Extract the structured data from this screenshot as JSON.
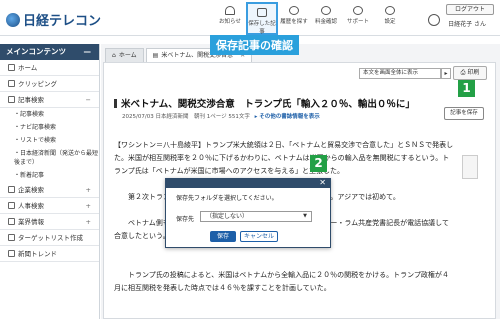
{
  "header": {
    "logo": "日経テレコン",
    "nav": [
      {
        "label": "お知らせ",
        "icon": "bell-icon"
      },
      {
        "label": "保存した記事",
        "icon": "folder-icon"
      },
      {
        "label": "履歴を探す",
        "icon": "history-icon"
      },
      {
        "label": "料金確認",
        "icon": "yen-icon"
      },
      {
        "label": "サポート",
        "icon": "help-icon"
      },
      {
        "label": "設定",
        "icon": "gear-icon"
      }
    ],
    "logout": "ログアウト",
    "username": "日経花子 さん"
  },
  "callout": "保存記事の確認",
  "sidebar": {
    "title": "メインコンテンツ",
    "items": [
      {
        "label": "ホーム"
      },
      {
        "label": "クリッピング"
      },
      {
        "label": "記事検索"
      }
    ],
    "sub_items": [
      "記事検索",
      "ナビ記事検索",
      "リストで検索",
      "日本経済新聞（発送から最短後まで）",
      "新着記事"
    ],
    "more_items": [
      {
        "label": "企業検索"
      },
      {
        "label": "人事検索"
      },
      {
        "label": "業界情報"
      },
      {
        "label": "ターゲットリスト作成"
      },
      {
        "label": "新聞トレンド"
      }
    ]
  },
  "tabs": [
    {
      "label": "ホーム"
    },
    {
      "label": "米ベトナム、関税交渉合意"
    }
  ],
  "toolbar": {
    "select": "本文を画面全体に表示",
    "print": "印刷"
  },
  "article": {
    "headline": "米ベトナム、関税交渉合意　トランプ氏「輸入２０％、輸出０％に」",
    "meta": "2025/07/03 日本経済新聞　朝刊 1ページ 551文字",
    "meta_link": "その他の書誌情報を表示",
    "save": "記事を保存",
    "paragraphs": [
      "【ワシントン＝八十島綾平】トランプ米大統領は２日、「ベトナムと貿易交渉で合意した」とＳＮＳで発表した。米国が相互関税率を２０％に下げるかわりに、ベトナムは米国からの輸入品を無関税にするという。トランプ氏は「ベトナムが米国に市場へのアクセスを与える」と主張した。",
      "第２次トランプ政権下での貿易合意は英国に続いて２例目となる。アジアでは初めて。",
      "ベトナム側も発表した。トランプ氏とベトナム共産党書記長のトー・ラム共産党書記長が電話協議して合意したという。",
      "トランプ氏の投稿によると、米国はベトナムから全輸入品に２０％の関税をかける。トランプ政権が４月に相互関税を発表した時点では４６％を課すことを計画していた。"
    ]
  },
  "dialog": {
    "message": "保存先フォルダを選択してください。",
    "label": "保存先",
    "select": "（指定しない）",
    "ok": "保存",
    "cancel": "キャンセル"
  },
  "badges": [
    "1",
    "2"
  ],
  "colors": {
    "brand": "#1d4f86",
    "accent": "#2aa0dc",
    "badge": "#23a046"
  }
}
